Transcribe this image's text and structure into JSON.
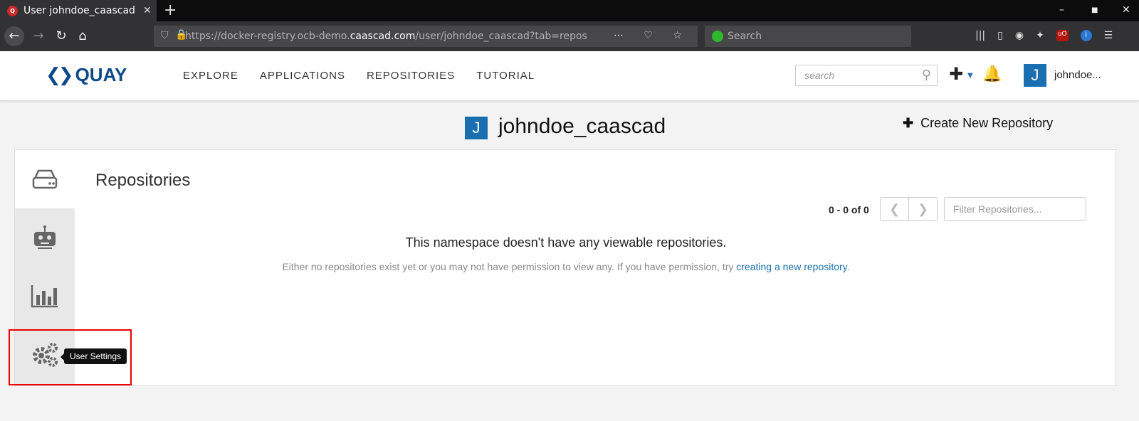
{
  "browser": {
    "tab_title": "User johndoe_caascad · Quay",
    "url_prefix": "https://docker-registry.ocb-demo.",
    "url_domain": "caascad.com",
    "url_path": "/user/johndoe_caascad?tab=repos",
    "search_placeholder": "Search"
  },
  "header": {
    "logo_text": "QUAY",
    "menu": [
      "EXPLORE",
      "APPLICATIONS",
      "REPOSITORIES",
      "TUTORIAL"
    ],
    "search_placeholder": "search",
    "avatar_letter": "J",
    "username": "johndoe..."
  },
  "page": {
    "avatar_letter": "J",
    "title": "johndoe_caascad",
    "create_repo_label": "Create New Repository"
  },
  "repos": {
    "heading": "Repositories",
    "pager_count": "0 - 0 of 0",
    "pager_prev": "❮",
    "pager_next": "❯",
    "filter_placeholder": "Filter Repositories...",
    "empty_title": "This namespace doesn't have any viewable repositories.",
    "empty_sub": "Either no repositories exist yet or you may not have permission to view any. If you have permission, try ",
    "empty_link": "creating a new repository",
    "empty_end": "."
  },
  "tooltip": "User Settings",
  "colors": {
    "accent": "#1a6fb0",
    "highlight": "#e00000"
  }
}
